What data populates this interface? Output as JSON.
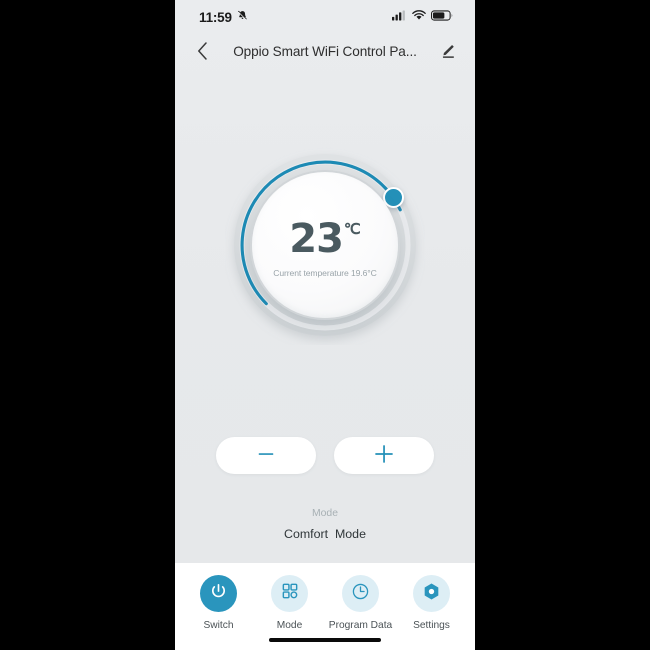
{
  "theme": {
    "accent": "#2a95bd",
    "accent_light": "#ddeef5",
    "screen_bg": "#e8eaec",
    "nav_bg": "#ffffff",
    "letterbox": "#000000",
    "temp_text": "#4a5a60"
  },
  "status_bar": {
    "time": "11:59",
    "mute_icon": "bell-muted-icon",
    "signal_icon": "cellular-signal-icon",
    "wifi_icon": "wifi-icon",
    "battery_icon": "battery-icon"
  },
  "title_bar": {
    "back_icon": "back-chevron-icon",
    "title": "Oppio Smart WiFi Control Pa...",
    "edit_icon": "pencil-edit-icon"
  },
  "thermostat": {
    "target_temp": "23",
    "unit": "℃",
    "current_temp_text": "Current temperature 19.6°C",
    "arc_start_deg": 135,
    "arc_sweep_deg": 250,
    "knob_position_deg": 25
  },
  "controls": {
    "decrease_label": "−",
    "decrease_icon": "minus-icon",
    "increase_label": "+",
    "increase_icon": "plus-icon"
  },
  "mode": {
    "label": "Mode",
    "value": "Comfort  Mode"
  },
  "bottom_nav": {
    "items": [
      {
        "label": "Switch",
        "icon": "power-icon",
        "active": true
      },
      {
        "label": "Mode",
        "icon": "grid-icon",
        "active": false
      },
      {
        "label": "Program Data",
        "icon": "clock-icon",
        "active": false
      },
      {
        "label": "Settings",
        "icon": "hex-nut-icon",
        "active": false
      }
    ]
  }
}
